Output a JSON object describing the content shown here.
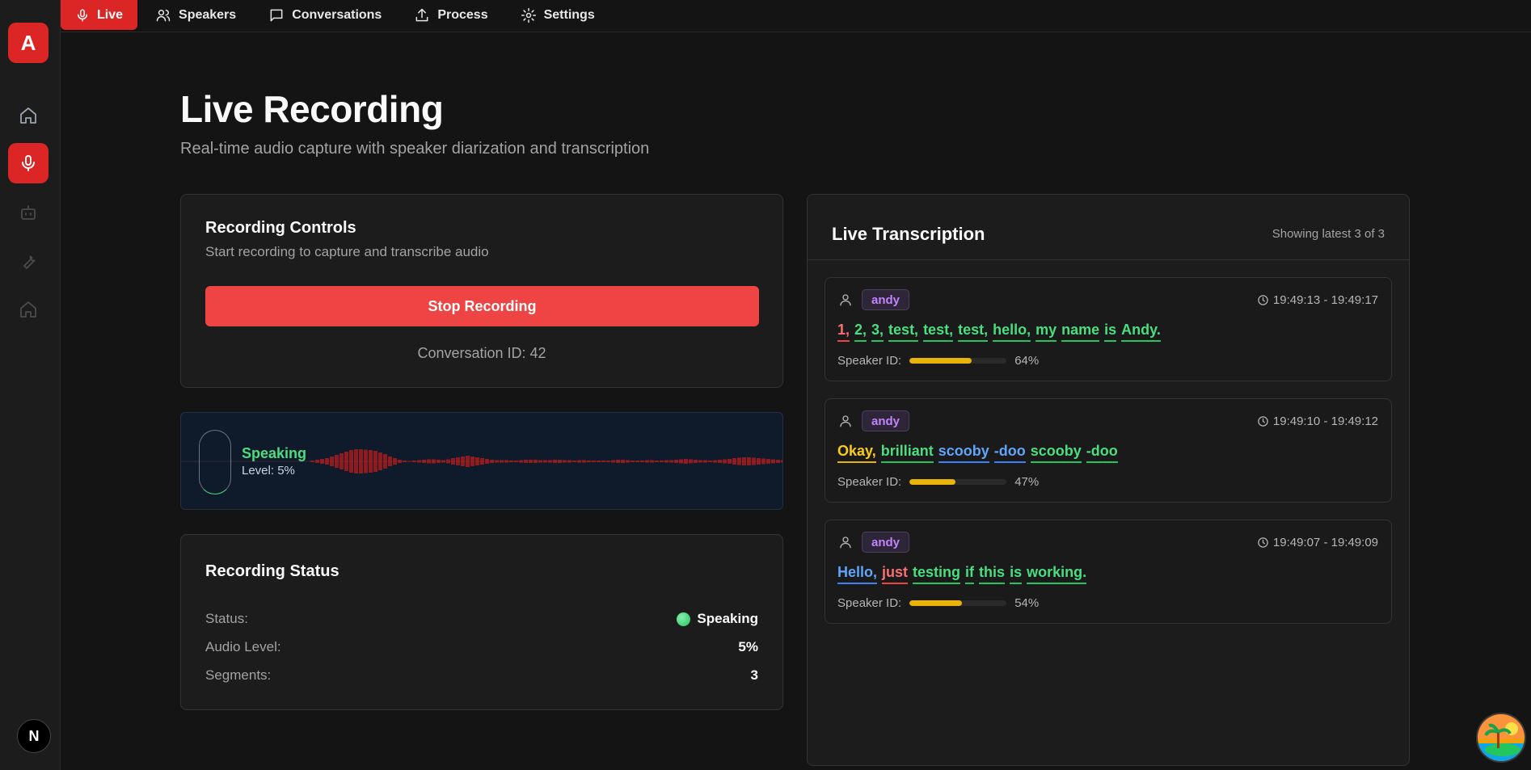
{
  "app": {
    "logo_letter": "A",
    "footer_badge": "N",
    "accent_color": "#dc2626"
  },
  "sidebar": {
    "items": [
      {
        "icon": "home-icon",
        "active": false
      },
      {
        "icon": "microphone-icon",
        "active": true
      },
      {
        "icon": "robot-icon",
        "active": false
      },
      {
        "icon": "wrench-icon",
        "active": false
      },
      {
        "icon": "home-icon",
        "active": false
      }
    ]
  },
  "nav": {
    "tabs": [
      {
        "label": "Live",
        "icon": "microphone-icon",
        "active": true
      },
      {
        "label": "Speakers",
        "icon": "users-icon",
        "active": false
      },
      {
        "label": "Conversations",
        "icon": "message-icon",
        "active": false
      },
      {
        "label": "Process",
        "icon": "upload-icon",
        "active": false
      },
      {
        "label": "Settings",
        "icon": "gear-icon",
        "active": false
      }
    ]
  },
  "header": {
    "title": "Live Recording",
    "subtitle": "Real-time audio capture with speaker diarization and transcription"
  },
  "controls": {
    "title": "Recording Controls",
    "description": "Start recording to capture and transcribe audio",
    "stop_label": "Stop Recording",
    "conversation_id": "Conversation ID: 42"
  },
  "visualizer": {
    "state": "Speaking",
    "level_text": "Level: 5%",
    "level": 0.05
  },
  "status": {
    "title": "Recording Status",
    "status_label": "Status:",
    "status_value": "Speaking",
    "audio_label": "Audio Level:",
    "audio_value": "5%",
    "segments_label": "Segments:",
    "segments_value": "3"
  },
  "transcription": {
    "title": "Live Transcription",
    "count_text": "Showing latest 3 of 3",
    "speaker_id_label": "Speaker ID:",
    "segments": [
      {
        "speaker": "andy",
        "time": "19:49:13 - 19:49:17",
        "words": [
          {
            "t": "1,",
            "c": "red"
          },
          {
            "t": "2,",
            "c": "green"
          },
          {
            "t": "3,",
            "c": "green"
          },
          {
            "t": "test,",
            "c": "green"
          },
          {
            "t": "test,",
            "c": "green"
          },
          {
            "t": "test,",
            "c": "green"
          },
          {
            "t": "hello,",
            "c": "green"
          },
          {
            "t": "my",
            "c": "green"
          },
          {
            "t": "name",
            "c": "green"
          },
          {
            "t": "is",
            "c": "green"
          },
          {
            "t": "Andy.",
            "c": "green"
          }
        ],
        "confidence": 0.64,
        "confidence_text": "64%"
      },
      {
        "speaker": "andy",
        "time": "19:49:10 - 19:49:12",
        "words": [
          {
            "t": "Okay,",
            "c": "yellow"
          },
          {
            "t": "brilliant",
            "c": "green"
          },
          {
            "t": "scooby",
            "c": "blue"
          },
          {
            "t": "-doo",
            "c": "blue"
          },
          {
            "t": "scooby",
            "c": "green"
          },
          {
            "t": "-doo",
            "c": "green"
          }
        ],
        "confidence": 0.47,
        "confidence_text": "47%"
      },
      {
        "speaker": "andy",
        "time": "19:49:07 - 19:49:09",
        "words": [
          {
            "t": "Hello,",
            "c": "blue"
          },
          {
            "t": "just",
            "c": "red"
          },
          {
            "t": "testing",
            "c": "green"
          },
          {
            "t": "if",
            "c": "green"
          },
          {
            "t": "this",
            "c": "green"
          },
          {
            "t": "is",
            "c": "green"
          },
          {
            "t": "working.",
            "c": "green"
          }
        ],
        "confidence": 0.54,
        "confidence_text": "54%"
      }
    ]
  }
}
